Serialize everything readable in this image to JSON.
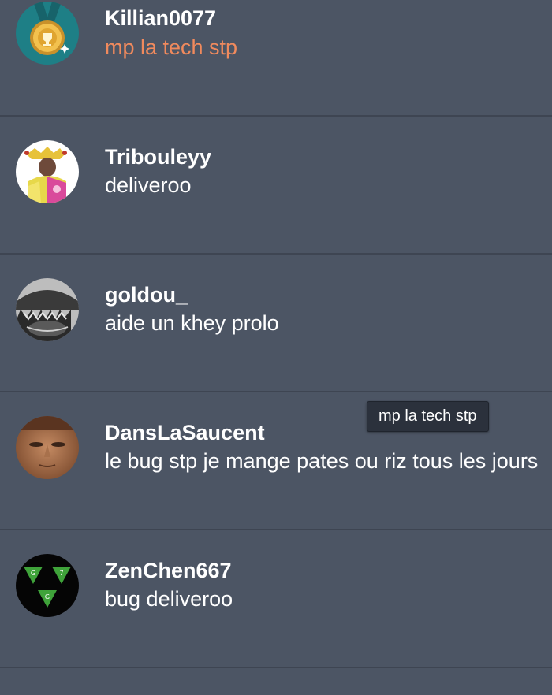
{
  "conversations": [
    {
      "username": "Killian0077",
      "message": "mp la tech stp",
      "highlighted": true,
      "avatar_icon": "gold-medal-icon"
    },
    {
      "username": "Tribouleyy",
      "message": "deliveroo",
      "highlighted": false,
      "avatar_icon": "jester-avatar"
    },
    {
      "username": "goldou_",
      "message": "aide un khey prolo",
      "highlighted": false,
      "avatar_icon": "monster-avatar"
    },
    {
      "username": "DansLaSaucent",
      "message": "le bug stp je mange pates ou riz tous les jours",
      "highlighted": false,
      "avatar_icon": "face-avatar"
    },
    {
      "username": "ZenChen667",
      "message": "bug deliveroo",
      "highlighted": false,
      "avatar_icon": "triangle-logo-avatar"
    }
  ],
  "tooltip": {
    "text": "mp la tech stp"
  },
  "colors": {
    "background": "#4c5564",
    "divider": "#3e4552",
    "highlight_text": "#f08a5d",
    "tooltip_bg": "#2b313c"
  }
}
